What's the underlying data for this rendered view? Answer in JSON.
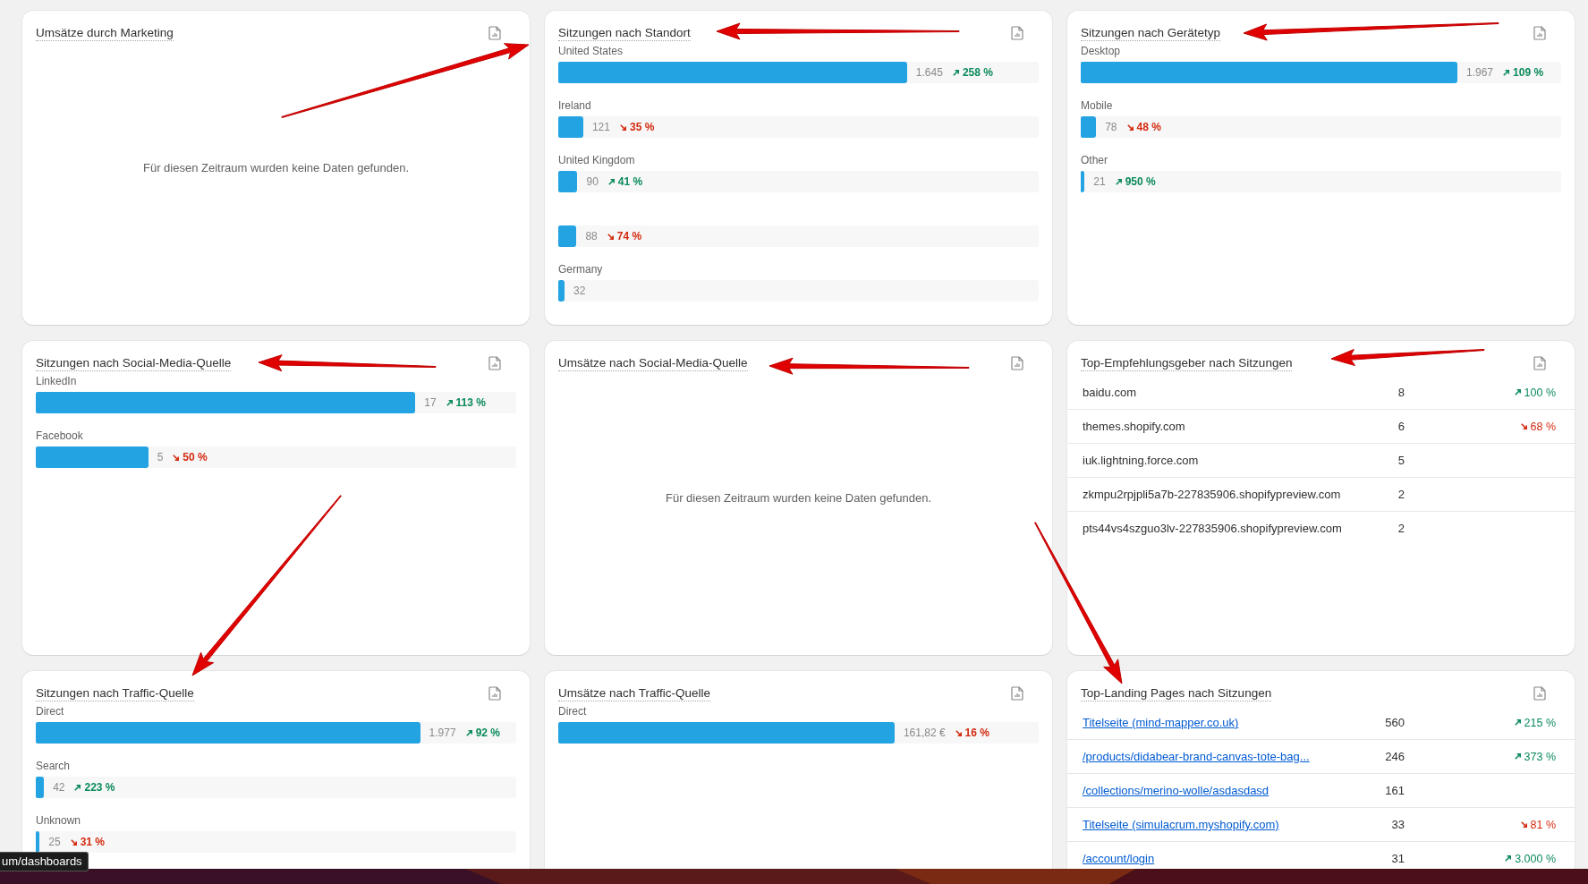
{
  "cards": [
    {
      "kind": "empty",
      "title": "Umsätze durch Marketing",
      "message": "Für diesen Zeitraum wurden keine Daten gefunden."
    },
    {
      "kind": "bars",
      "title": "Sitzungen nach Standort",
      "rows": [
        {
          "label": "United States",
          "level": 0.726,
          "value": "1.645",
          "trend": {
            "rising": true,
            "text": "258 %"
          }
        },
        {
          "label": "Ireland",
          "level": 0.052,
          "value": "121",
          "trend": {
            "rising": false,
            "text": "35 %"
          }
        },
        {
          "label": "United Kingdom",
          "level": 0.04,
          "value": "90",
          "trend": {
            "rising": true,
            "text": "41 %"
          }
        },
        {
          "level": 0.038,
          "value": "88",
          "trend": {
            "rising": false,
            "text": "74 %"
          }
        },
        {
          "label": "Germany",
          "level": 0.013,
          "value": "32"
        }
      ]
    },
    {
      "kind": "bars",
      "title": "Sitzungen nach Gerätetyp",
      "rows": [
        {
          "label": "Desktop",
          "level": 0.784,
          "value": "1.967",
          "trend": {
            "rising": true,
            "text": "109 %"
          }
        },
        {
          "label": "Mobile",
          "level": 0.032,
          "value": "78",
          "trend": {
            "rising": false,
            "text": "48 %"
          }
        },
        {
          "label": "Other",
          "level": 0.008,
          "value": "21",
          "trend": {
            "rising": true,
            "text": "950 %"
          }
        }
      ]
    },
    {
      "kind": "bars",
      "title": "Sitzungen nach Social-Media-Quelle",
      "rows": [
        {
          "label": "LinkedIn",
          "level": 0.79,
          "value": "17",
          "trend": {
            "rising": true,
            "text": "113 %"
          }
        },
        {
          "label": "Facebook",
          "level": 0.234,
          "value": "5",
          "trend": {
            "rising": false,
            "text": "50 %"
          }
        }
      ]
    },
    {
      "kind": "empty",
      "title": "Umsätze nach Social-Media-Quelle",
      "message": "Für diesen Zeitraum wurden keine Daten gefunden."
    },
    {
      "kind": "table",
      "title": "Top-Empfehlungsgeber nach Sitzungen",
      "rows": [
        {
          "name": "baidu.com",
          "count": "8",
          "trend": {
            "rising": true,
            "text": "100 %"
          }
        },
        {
          "name": "themes.shopify.com",
          "count": "6",
          "trend": {
            "rising": false,
            "text": "68 %"
          }
        },
        {
          "name": "iuk.lightning.force.com",
          "count": "5"
        },
        {
          "name": "zkmpu2rpjpli5a7b-227835906.shopifypreview.com",
          "count": "2"
        },
        {
          "name": "pts44vs4szguo3lv-227835906.shopifypreview.com",
          "count": "2"
        }
      ]
    },
    {
      "kind": "bars",
      "title": "Sitzungen nach Traffic-Quelle",
      "rows": [
        {
          "label": "Direct",
          "level": 0.8,
          "value": "1.977",
          "trend": {
            "rising": true,
            "text": "92 %"
          }
        },
        {
          "label": "Search",
          "level": 0.017,
          "value": "42",
          "trend": {
            "rising": true,
            "text": "223 %"
          }
        },
        {
          "label": "Unknown",
          "level": 0.008,
          "value": "25",
          "trend": {
            "rising": false,
            "text": "31 %"
          }
        }
      ]
    },
    {
      "kind": "bars",
      "title": "Umsätze nach Traffic-Quelle",
      "rows": [
        {
          "label": "Direct",
          "level": 0.7,
          "value": "161,82 €",
          "trend": {
            "rising": false,
            "text": "16 %"
          }
        }
      ]
    },
    {
      "kind": "table",
      "links": true,
      "title": "Top-Landing Pages nach Sitzungen",
      "rows": [
        {
          "name": "Titelseite (mind-mapper.co.uk)",
          "count": "560",
          "trend": {
            "rising": true,
            "text": "215 %"
          }
        },
        {
          "name": "/products/didabear-brand-canvas-tote-bag...",
          "count": "246",
          "trend": {
            "rising": true,
            "text": "373 %"
          }
        },
        {
          "name": "/collections/merino-wolle/asdasdasd",
          "count": "161"
        },
        {
          "name": "Titelseite (simulacrum.myshopify.com)",
          "count": "33",
          "trend": {
            "rising": false,
            "text": "81 %"
          }
        },
        {
          "name": "/account/login",
          "count": "31",
          "trend": {
            "rising": true,
            "text": "3.000 %"
          }
        }
      ]
    }
  ],
  "link_preview": {
    "url": "um/dashboards"
  }
}
